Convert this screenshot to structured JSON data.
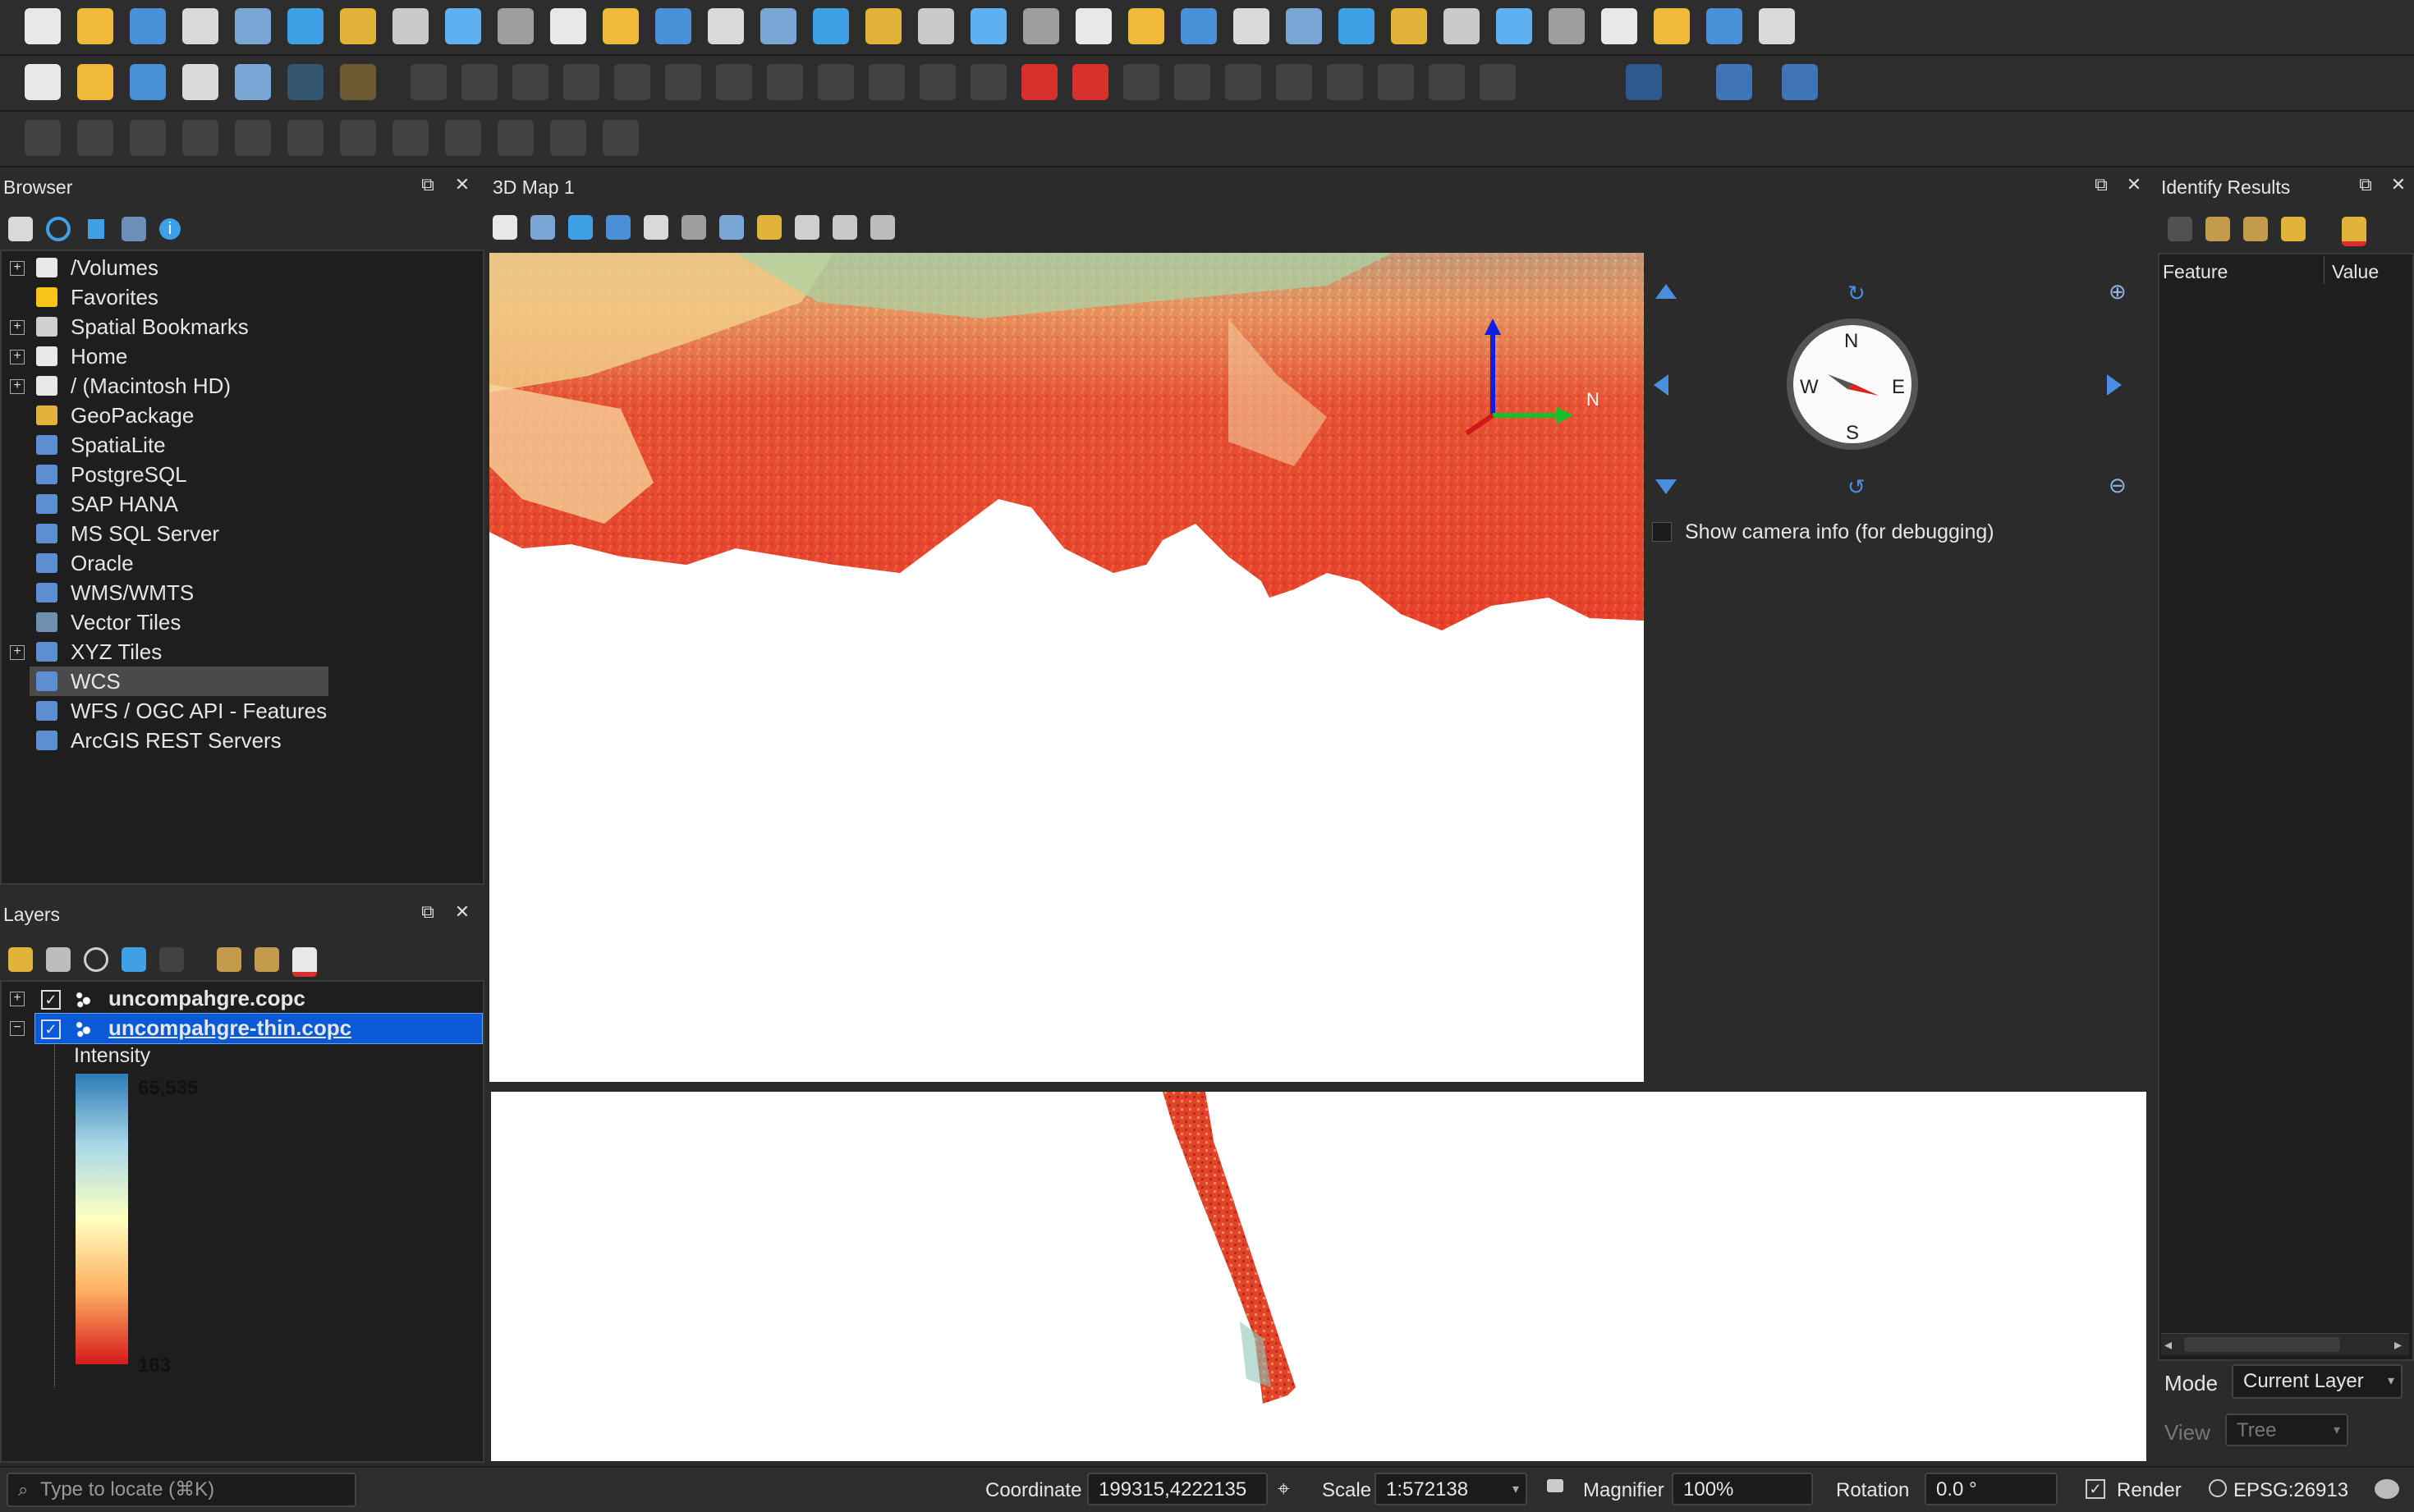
{
  "toolbar": {
    "row1_icons": [
      "new-project-icon",
      "open-project-icon",
      "save-project-icon",
      "save-as-icon",
      "print-layout-icon",
      "style-manager-icon",
      "pan-map-icon",
      "pan-to-selection-icon",
      "zoom-in-icon",
      "zoom-out-icon",
      "zoom-full-icon",
      "zoom-to-selection-icon",
      "zoom-to-layer-icon",
      "zoom-native-icon",
      "zoom-last-icon",
      "zoom-next-icon",
      "new-map-view-icon",
      "new-3d-view-icon",
      "new-bookmark-icon",
      "show-bookmarks-icon",
      "temporal-controller-icon",
      "refresh-icon",
      "identify-select-icon",
      "select-features-icon",
      "deselect-icon",
      "select-by-location-icon",
      "identify-features-icon",
      "open-field-calculator-icon",
      "processing-toolbox-icon",
      "statistical-summary-icon",
      "attribute-table-icon",
      "measure-line-icon",
      "map-tips-icon",
      "spatial-settings-icon"
    ],
    "row2_icons": [
      "data-source-manager-icon",
      "new-geopackage-icon",
      "new-temp-scratch-icon",
      "digitize-icon",
      "add-feature-icon",
      "vertex-tool-icon",
      "identify-icon"
    ]
  },
  "browser": {
    "title": "Browser",
    "items": [
      {
        "label": "/Volumes",
        "icon": "folder-icon",
        "expandable": true
      },
      {
        "label": "Favorites",
        "icon": "star-icon",
        "expandable": false
      },
      {
        "label": "Spatial Bookmarks",
        "icon": "bookmark-icon",
        "expandable": true
      },
      {
        "label": "Home",
        "icon": "home-icon",
        "expandable": true
      },
      {
        "label": "/ (Macintosh HD)",
        "icon": "folder-icon",
        "expandable": true
      },
      {
        "label": "GeoPackage",
        "icon": "geopackage-icon",
        "expandable": false
      },
      {
        "label": "SpatiaLite",
        "icon": "spatialite-icon",
        "expandable": false
      },
      {
        "label": "PostgreSQL",
        "icon": "postgresql-icon",
        "expandable": false
      },
      {
        "label": "SAP HANA",
        "icon": "sap-hana-icon",
        "expandable": false
      },
      {
        "label": "MS SQL Server",
        "icon": "mssql-icon",
        "expandable": false
      },
      {
        "label": "Oracle",
        "icon": "oracle-icon",
        "expandable": false
      },
      {
        "label": "WMS/WMTS",
        "icon": "wms-icon",
        "expandable": false
      },
      {
        "label": "Vector Tiles",
        "icon": "vector-tiles-icon",
        "expandable": false
      },
      {
        "label": "XYZ Tiles",
        "icon": "xyz-tiles-icon",
        "expandable": true
      },
      {
        "label": "WCS",
        "icon": "wcs-icon",
        "expandable": false
      },
      {
        "label": "WFS / OGC API - Features",
        "icon": "wfs-icon",
        "expandable": false
      },
      {
        "label": "ArcGIS REST Servers",
        "icon": "arcgis-icon",
        "expandable": false
      }
    ]
  },
  "layers": {
    "title": "Layers",
    "items": [
      {
        "label": "uncompahgre.copc",
        "checked": true
      },
      {
        "label": "uncompahgre-thin.copc",
        "checked": true
      }
    ],
    "legend": {
      "attribute": "Intensity",
      "max": "65,535",
      "min": "163"
    }
  },
  "map3d": {
    "title": "3D Map 1",
    "compass": {
      "n": "N",
      "e": "E",
      "s": "S",
      "w": "W"
    },
    "axis_label": "N",
    "camera_info_label": "Show camera info (for debugging)"
  },
  "identify": {
    "title": "Identify Results",
    "columns": [
      "Feature",
      "Value"
    ],
    "mode_label": "Mode",
    "mode_value": "Current Layer",
    "view_label": "View",
    "view_value": "Tree"
  },
  "status": {
    "locate_placeholder": "Type to locate (⌘K)",
    "coordinate_label": "Coordinate",
    "coordinate_value": "199315,4222135",
    "scale_label": "Scale",
    "scale_value": "1:572138",
    "magnifier_label": "Magnifier",
    "magnifier_value": "100%",
    "rotation_label": "Rotation",
    "rotation_value": "0.0 °",
    "render_label": "Render",
    "crs": "EPSG:26913"
  },
  "colors": {
    "ramp_top": "#2c7bb6",
    "ramp_mid": "#ffffbf",
    "ramp_bottom": "#d7191c",
    "selection": "#0a5ad8"
  }
}
